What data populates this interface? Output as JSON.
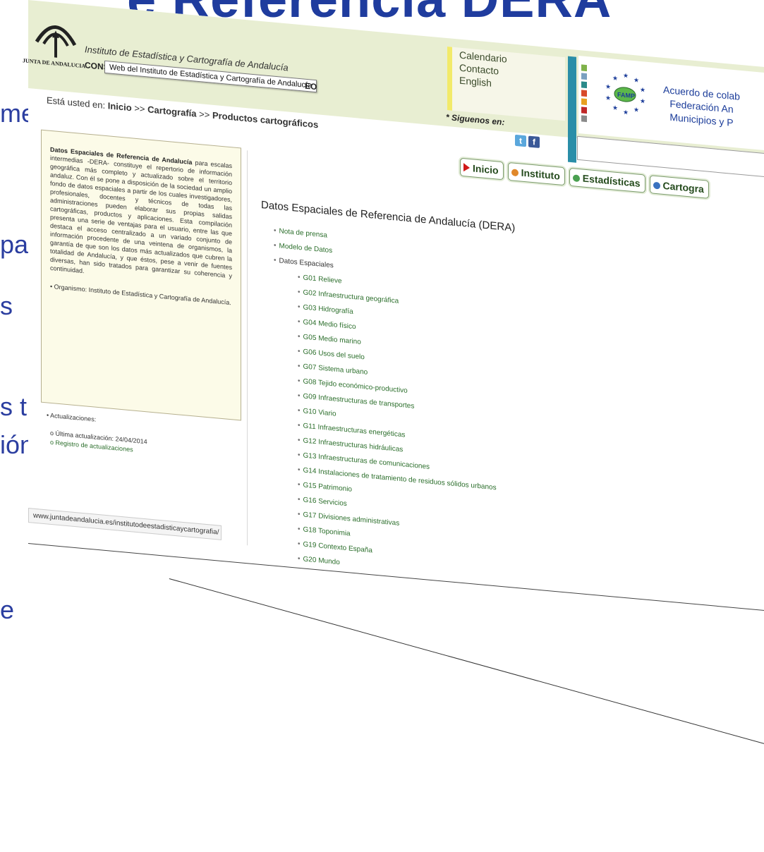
{
  "slide": {
    "title": "e Referencia DERA",
    "words": [
      "mente",
      "para",
      "s",
      "s tipos",
      "ión",
      "e"
    ]
  },
  "header": {
    "junta_caption": "JUNTA DE ANDALUCIA",
    "institute_name": "Instituto de Estadística y Cartografía de Andalucía",
    "consejeria": "CONSE",
    "consejeria_end": "EO",
    "tooltip": "Web del Instituto de Estadística y Cartografía de Andalucía",
    "links": [
      "Calendario",
      "Contacto",
      "English"
    ],
    "follow_label": "* Siguenos en:",
    "social": [
      "twitter-icon",
      "facebook-icon"
    ],
    "agreement_text": [
      "Acuerdo de colab",
      "Federación An",
      "Municipios y P"
    ],
    "colors": {
      "header_bg": "#e8eed2",
      "accent_blue": "#2a8ea8",
      "link_green": "#2b6e2b"
    }
  },
  "breadcrumb": {
    "prefix": "Está usted en:",
    "items": [
      "Inicio",
      "Cartografía",
      "Productos cartográficos"
    ],
    "separator": ">>"
  },
  "nav_tabs": [
    {
      "label": "Inicio",
      "icon": "red-triangle",
      "color": "#d01818"
    },
    {
      "label": "Instituto",
      "icon": "dot",
      "color": "#e0882a"
    },
    {
      "label": "Estadísticas",
      "icon": "dot",
      "color": "#4aa050"
    },
    {
      "label": "Cartogra",
      "icon": "dot",
      "color": "#3a72c0"
    }
  ],
  "left_panel": {
    "intro_bold": "Datos Espaciales de Referencia de Andalucía",
    "intro_text": " para escalas intermedias -DERA- constituye el repertorio de información geográfica más completo y actualizado sobre el territorio andaluz. Con él se pone a disposición de la sociedad un amplio fondo de datos espaciales a partir de los cuales investigadores, profesionales, docentes y técnicos de todas las administraciones pueden elaborar sus propias salidas cartográficas, productos y aplicaciones. Esta compilación presenta una serie de ventajas para el usuario, entre las que destaca el acceso centralizado a un variado conjunto de información procedente de una veintena de organismos, la garantía de que son los datos más actualizados que cubren la totalidad de Andalucía, y que éstos, pese a venir de fuentes diversas, han sido tratados para garantizar su coherencia y continuidad.",
    "organism": "Organismo: Instituto de Estadística y Cartografía de Andalucía.",
    "updates_heading": "Actualizaciones:",
    "last_update": "Última actualización: 24/04/2014",
    "update_log": "Registro de actualizaciones"
  },
  "status_url": "www.juntadeandalucia.es/institutodeestadisticaycartografia/",
  "main": {
    "title": "Datos Espaciales de Referencia de Andalucía (DERA)",
    "items": [
      "Nota de prensa",
      "Modelo de Datos",
      "Datos Espaciales"
    ],
    "groups": [
      "G01 Relieve",
      "G02 Infraestructura geográfica",
      "G03 Hidrografía",
      "G04 Medio físico",
      "G05 Medio marino",
      "G06 Usos del suelo",
      "G07 Sistema urbano",
      "G08 Tejido económico-productivo",
      "G09 Infraestructuras de transportes",
      "G10 Viario",
      "G11 Infraestructuras energéticas",
      "G12 Infraestructuras hidráulicas",
      "G13 Infraestructuras de comunicaciones",
      "G14 Instalaciones de tratamiento de residuos sólidos urbanos",
      "G15 Patrimonio",
      "G16 Servicios",
      "G17 Divisiones administrativas",
      "G18 Toponimia",
      "G19 Contexto España",
      "G20 Mundo"
    ]
  }
}
